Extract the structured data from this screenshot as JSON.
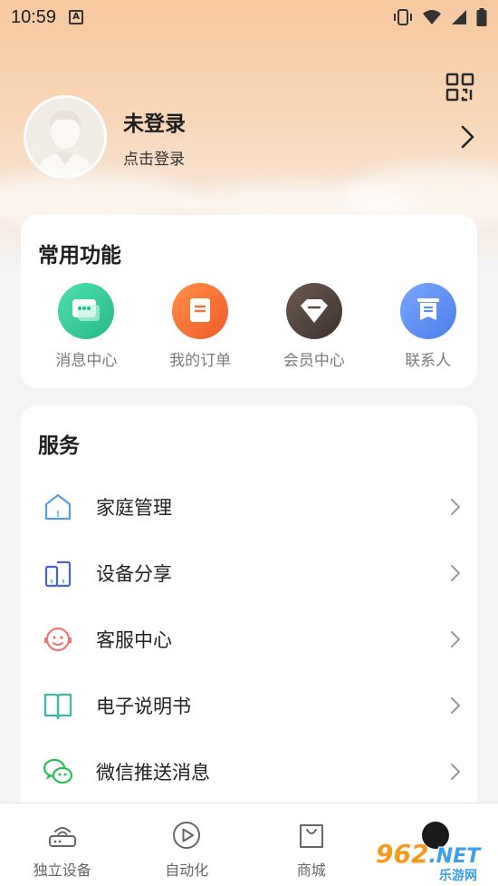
{
  "status_bar": {
    "time": "10:59",
    "notification_icon": "a-icon",
    "right_icons": [
      "vibrate-icon",
      "wifi-icon",
      "signal-icon",
      "battery-icon"
    ]
  },
  "profile": {
    "name": "未登录",
    "subtitle": "点击登录"
  },
  "common_functions": {
    "title": "常用功能",
    "items": [
      {
        "label": "消息中心",
        "icon": "message-icon",
        "color": "#3ccf9a"
      },
      {
        "label": "我的订单",
        "icon": "order-icon",
        "color": "#f4763a"
      },
      {
        "label": "会员中心",
        "icon": "diamond-icon",
        "color": "#5a4a44"
      },
      {
        "label": "联系人",
        "icon": "contacts-icon",
        "color": "#5c8ef2"
      }
    ]
  },
  "services": {
    "title": "服务",
    "items": [
      {
        "label": "家庭管理",
        "icon": "home-icon"
      },
      {
        "label": "设备分享",
        "icon": "device-share-icon"
      },
      {
        "label": "客服中心",
        "icon": "customer-service-icon"
      },
      {
        "label": "电子说明书",
        "icon": "manual-icon"
      },
      {
        "label": "微信推送消息",
        "icon": "wechat-icon"
      }
    ]
  },
  "tabbar": {
    "items": [
      {
        "label": "独立设备",
        "icon": "router-icon"
      },
      {
        "label": "自动化",
        "icon": "play-icon"
      },
      {
        "label": "商城",
        "icon": "shopping-bag-icon"
      },
      {
        "label": "",
        "icon": "profile-icon"
      }
    ]
  },
  "watermark": {
    "main": "962",
    "net": ".NET",
    "sub": "乐游网"
  }
}
